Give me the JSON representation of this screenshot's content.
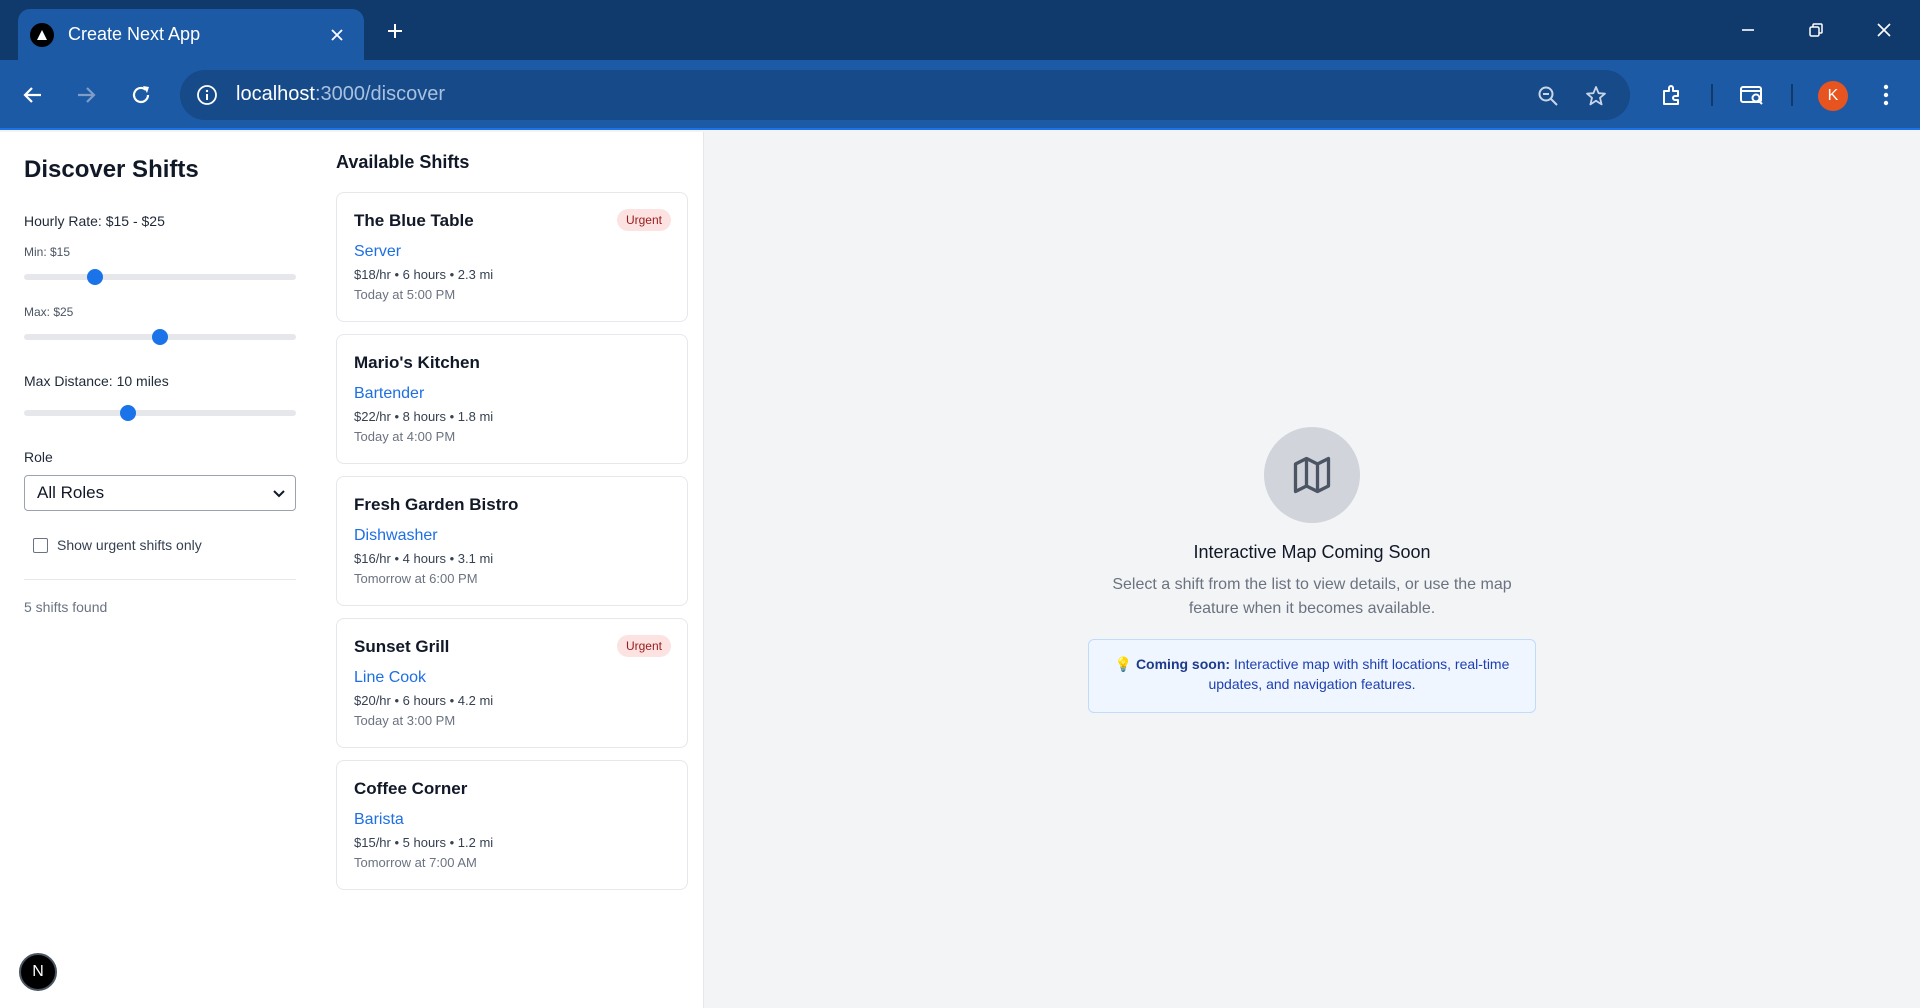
{
  "browser": {
    "tab_title": "Create Next App",
    "url_host": "localhost",
    "url_path": ":3000/discover",
    "profile_initial": "K"
  },
  "filters": {
    "title": "Discover Shifts",
    "hourly_rate_label": "Hourly Rate: $15 - $25",
    "min_label": "Min: $15",
    "max_label": "Max: $25",
    "min_value": 15,
    "max_value": 25,
    "distance_label": "Max Distance: 10 miles",
    "distance_value": 10,
    "role_label": "Role",
    "role_selected": "All Roles",
    "urgent_label": "Show urgent shifts only",
    "urgent_checked": false,
    "count_text": "5 shifts found"
  },
  "shifts": {
    "title": "Available Shifts",
    "items": [
      {
        "business": "The Blue Table",
        "badge": "Urgent",
        "role": "Server",
        "meta": "$18/hr • 6 hours • 2.3 mi",
        "when": "Today at 5:00 PM"
      },
      {
        "business": "Mario's Kitchen",
        "badge": "",
        "role": "Bartender",
        "meta": "$22/hr • 8 hours • 1.8 mi",
        "when": "Today at 4:00 PM"
      },
      {
        "business": "Fresh Garden Bistro",
        "badge": "",
        "role": "Dishwasher",
        "meta": "$16/hr • 4 hours • 3.1 mi",
        "when": "Tomorrow at 6:00 PM"
      },
      {
        "business": "Sunset Grill",
        "badge": "Urgent",
        "role": "Line Cook",
        "meta": "$20/hr • 6 hours • 4.2 mi",
        "when": "Today at 3:00 PM"
      },
      {
        "business": "Coffee Corner",
        "badge": "",
        "role": "Barista",
        "meta": "$15/hr • 5 hours • 1.2 mi",
        "when": "Tomorrow at 7:00 AM"
      }
    ]
  },
  "map": {
    "icon": "map-icon",
    "title": "Interactive Map Coming Soon",
    "subtitle": "Select a shift from the list to view details, or use the map feature when it becomes available.",
    "notice_emoji": "💡",
    "notice_bold": "Coming soon:",
    "notice_text": "Interactive map with shift locations, real-time updates, and navigation features."
  },
  "next_badge": "N",
  "colors": {
    "accent": "#1a73e8",
    "link": "#1d6fe3",
    "urgent_bg": "#fde2e2",
    "urgent_text": "#991b1b"
  }
}
